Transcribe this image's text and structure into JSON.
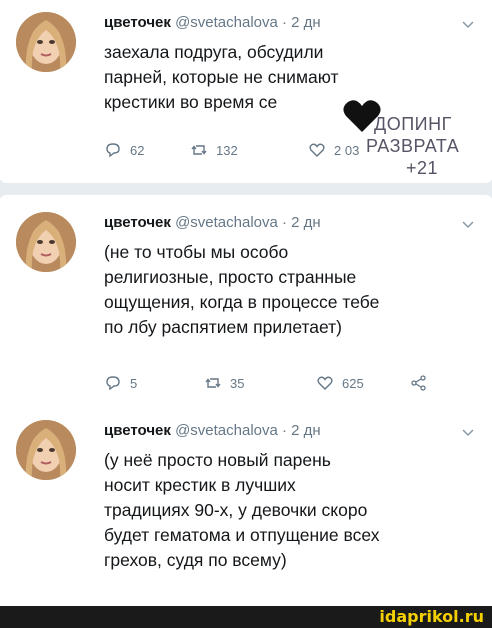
{
  "tweets": [
    {
      "name": "цветочек",
      "meta": "@svetachalova · 2 дн",
      "text": "заехала подруга, обсудили\nпарней, которые не снимают\nкрестики во время се",
      "reply_count": "62",
      "retweet_count": "132",
      "like_count": "2 03",
      "show_share": false
    },
    {
      "name": "цветочек",
      "meta": "@svetachalova · 2 дн",
      "text": "(не то чтобы мы особо\nрелигиозные, просто странные\nощущения, когда в процессе тебе\nпо лбу распятием прилетает)",
      "reply_count": "5",
      "retweet_count": "35",
      "like_count": "625",
      "show_share": true
    },
    {
      "name": "цветочек",
      "meta": "@svetachalova · 2 дн",
      "text": "(у неё просто новый парень\nносит крестик в лучших\nтрадициях 90-х, у девочки скоро\nбудет гематома и отпущение всех\nгрехов, судя по всему)"
    }
  ],
  "overlay": {
    "line1": "ДОПИНГ",
    "line2": "РАЗВРАТА",
    "line3": "+21"
  },
  "watermark": "idaprikol.ru",
  "colors": {
    "meta": "#657786",
    "divider": "#e6ecf0",
    "brand": "#f5d000"
  },
  "icons": [
    "reply-icon",
    "retweet-icon",
    "like-icon",
    "share-icon",
    "chevron-down-icon",
    "black-heart-icon"
  ]
}
